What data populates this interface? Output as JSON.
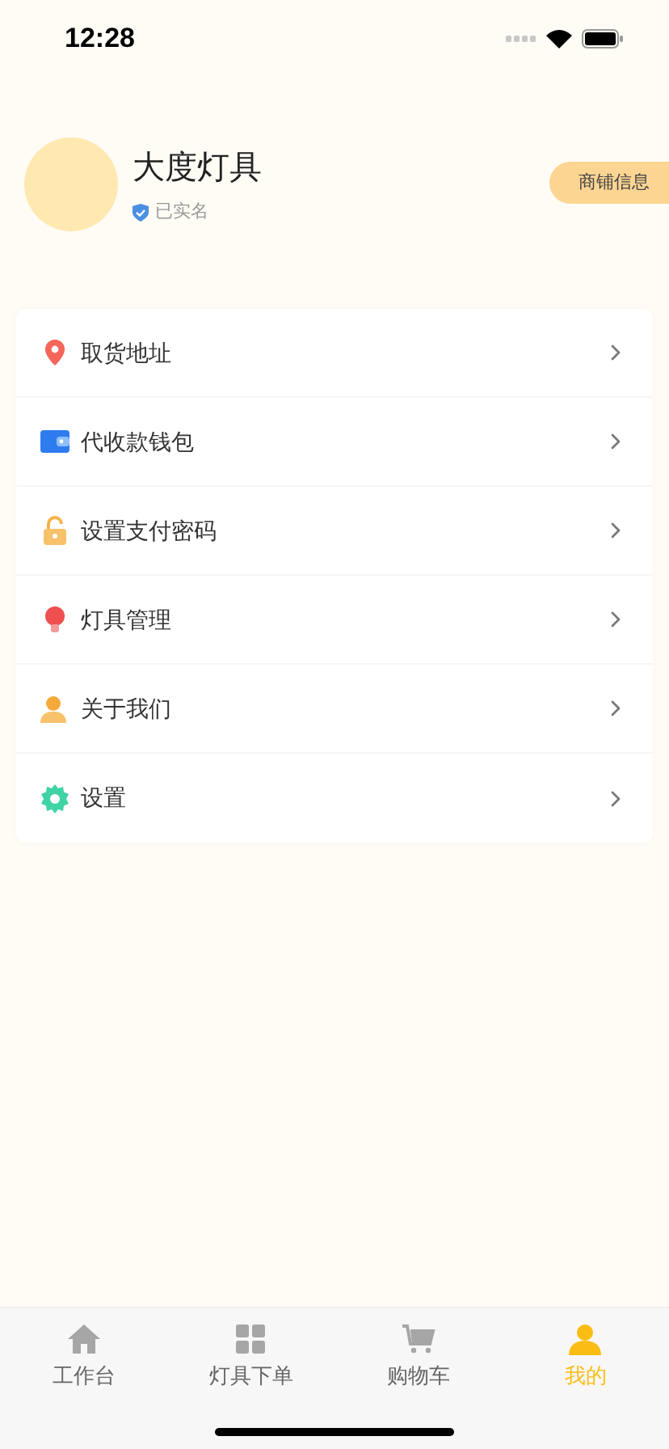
{
  "status_bar": {
    "time": "12:28"
  },
  "profile": {
    "name": "大度灯具",
    "verified": true,
    "verified_label": "已实名",
    "shop_button": "商铺信息"
  },
  "menu": [
    {
      "kind": "pin",
      "label": "取货地址"
    },
    {
      "kind": "wallet",
      "label": "代收款钱包"
    },
    {
      "kind": "lock",
      "label": "设置支付密码"
    },
    {
      "kind": "bulb",
      "label": "灯具管理"
    },
    {
      "kind": "person",
      "label": "关于我们"
    },
    {
      "kind": "gear",
      "label": "设置"
    }
  ],
  "tabs": [
    {
      "kind": "home",
      "label": "工作台",
      "selected": false
    },
    {
      "kind": "grid",
      "label": "灯具下单",
      "selected": false
    },
    {
      "kind": "cart",
      "label": "购物车",
      "selected": false
    },
    {
      "kind": "user",
      "label": "我的",
      "selected": true
    }
  ]
}
